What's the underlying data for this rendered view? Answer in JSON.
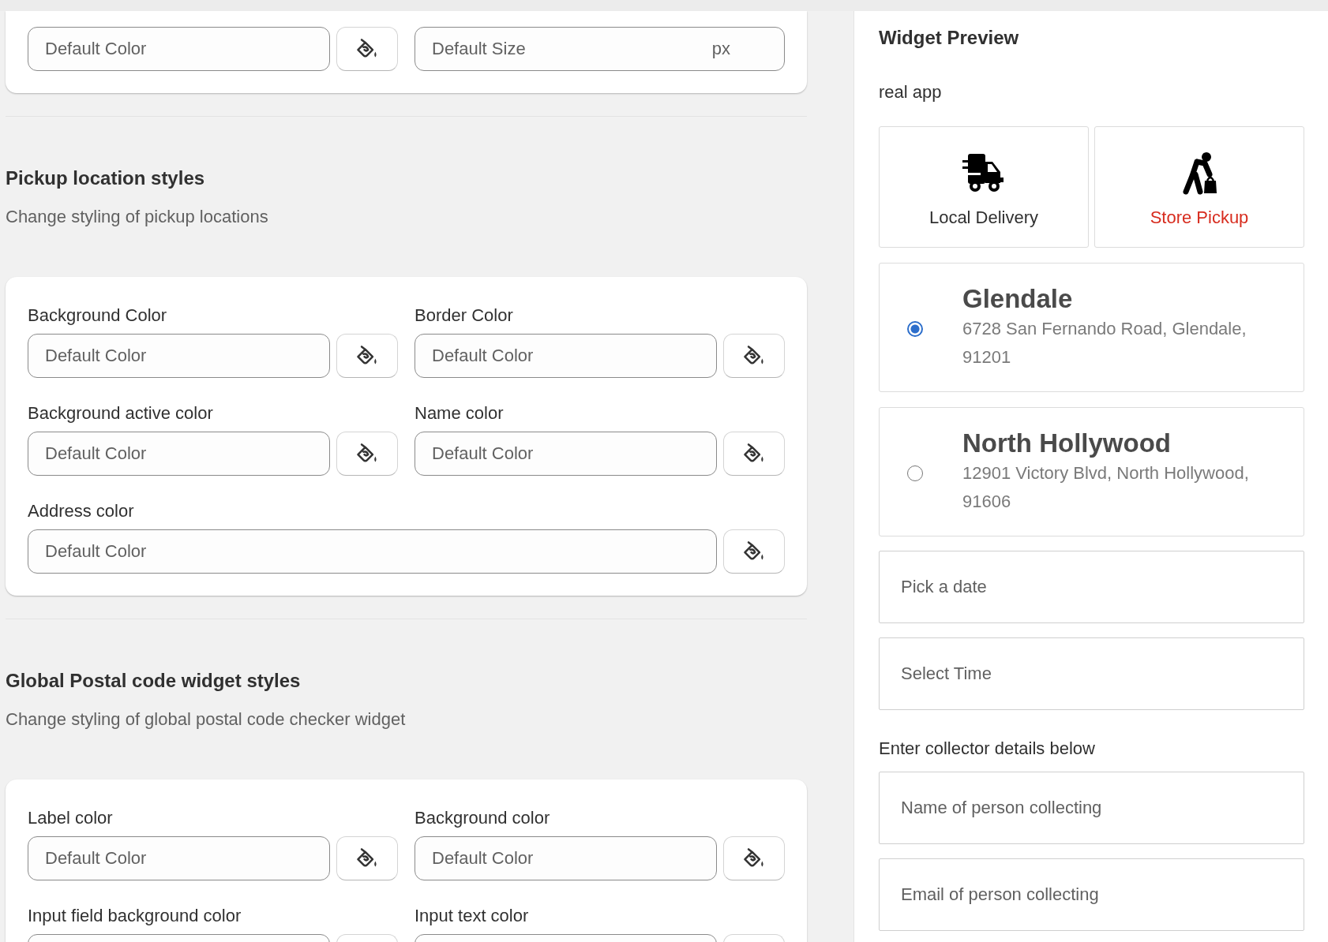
{
  "top_card": {
    "rows": [
      {
        "fields": [
          {
            "kind": "color",
            "placeholder": "Default Color"
          },
          {
            "kind": "size",
            "placeholder": "Default Size",
            "suffix": "px"
          }
        ]
      }
    ]
  },
  "sections": [
    {
      "title": "Pickup location styles",
      "description": "Change styling of pickup locations",
      "rows": [
        {
          "fields": [
            {
              "label": "Background Color",
              "kind": "color",
              "placeholder": "Default Color"
            },
            {
              "label": "Border Color",
              "kind": "color",
              "placeholder": "Default Color"
            }
          ]
        },
        {
          "fields": [
            {
              "label": "Background active color",
              "kind": "color",
              "placeholder": "Default Color"
            },
            {
              "label": "Name color",
              "kind": "color",
              "placeholder": "Default Color"
            }
          ]
        },
        {
          "fields": [
            {
              "label": "Address color",
              "kind": "color",
              "placeholder": "Default Color"
            }
          ]
        }
      ]
    },
    {
      "title": "Global Postal code widget styles",
      "description": "Change styling of global postal code checker widget",
      "rows": [
        {
          "fields": [
            {
              "label": "Label color",
              "kind": "color",
              "placeholder": "Default Color"
            },
            {
              "label": "Background color",
              "kind": "color",
              "placeholder": "Default Color"
            }
          ]
        },
        {
          "fields": [
            {
              "label": "Input field background color",
              "kind": "color"
            },
            {
              "label": "Input text color",
              "kind": "color"
            }
          ]
        }
      ]
    }
  ],
  "preview": {
    "title": "Widget Preview",
    "subtitle": "real app",
    "methods": [
      {
        "label": "Local Delivery",
        "kind": "delivery",
        "selected": false
      },
      {
        "label": "Store Pickup",
        "kind": "pickup",
        "selected": true
      }
    ],
    "locations": [
      {
        "name": "Glendale",
        "address": "6728 San Fernando Road, Glendale, 91201",
        "selected": true
      },
      {
        "name": "North Hollywood",
        "address": "12901 Victory Blvd, North Hollywood, 91606",
        "selected": false
      }
    ],
    "inputs": [
      {
        "placeholder": "Pick a date"
      },
      {
        "placeholder": "Select Time"
      }
    ],
    "collector_label": "Enter collector details below",
    "collector_inputs": [
      {
        "placeholder": "Name of person collecting"
      },
      {
        "placeholder": "Email of person collecting"
      }
    ]
  }
}
